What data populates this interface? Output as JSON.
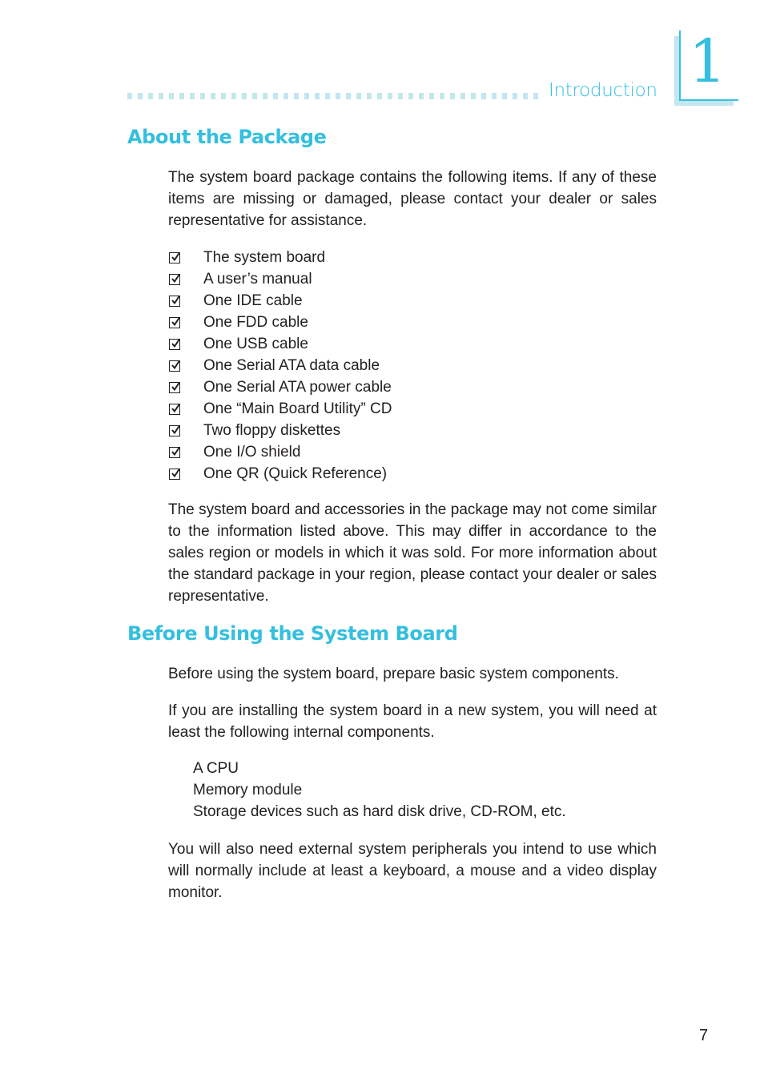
{
  "header": {
    "chapter_title": "Introduction",
    "chapter_number": "1",
    "accent_color": "#34bfdf",
    "light_accent_color": "#c3e6ef"
  },
  "section1": {
    "heading": "About the Package",
    "intro": "The system board package contains the following items. If any of these items are missing or damaged, please contact your dealer or sales representative for assistance.",
    "items": [
      {
        "label": "The system board",
        "icon": "checked-box-icon"
      },
      {
        "label": "A user’s manual",
        "icon": "checked-box-icon"
      },
      {
        "label": "One IDE cable",
        "icon": "checked-box-icon"
      },
      {
        "label": "One FDD cable",
        "icon": "checked-box-icon"
      },
      {
        "label": "One USB cable",
        "icon": "checked-box-icon"
      },
      {
        "label": "One Serial ATA data cable",
        "icon": "checked-box-icon"
      },
      {
        "label": "One Serial ATA power cable",
        "icon": "checked-box-icon"
      },
      {
        "label": "One “Main Board Utility” CD",
        "icon": "checked-box-icon"
      },
      {
        "label": "Two floppy diskettes",
        "icon": "checked-box-icon"
      },
      {
        "label": "One I/O shield",
        "icon": "checked-box-icon"
      },
      {
        "label": "One QR (Quick Reference)",
        "icon": "checked-box-icon"
      }
    ],
    "note": "The system board and accessories in the package may not come similar to the information listed above. This may differ in accordance to the sales region or models in which it was sold. For more information about the standard package in your region, please contact your dealer or sales representative."
  },
  "section2": {
    "heading": "Before Using the System Board",
    "para1": "Before using the system board, prepare basic system components.",
    "para2": "If you are installing the system board in a new system, you will need at least the following internal components.",
    "components": [
      "A CPU",
      "Memory module",
      "Storage devices such as hard disk drive, CD-ROM, etc."
    ],
    "para3": "You will also need external system peripherals you intend to use which will normally include at least a keyboard, a mouse and a video display monitor."
  },
  "footer": {
    "page_number": "7"
  }
}
